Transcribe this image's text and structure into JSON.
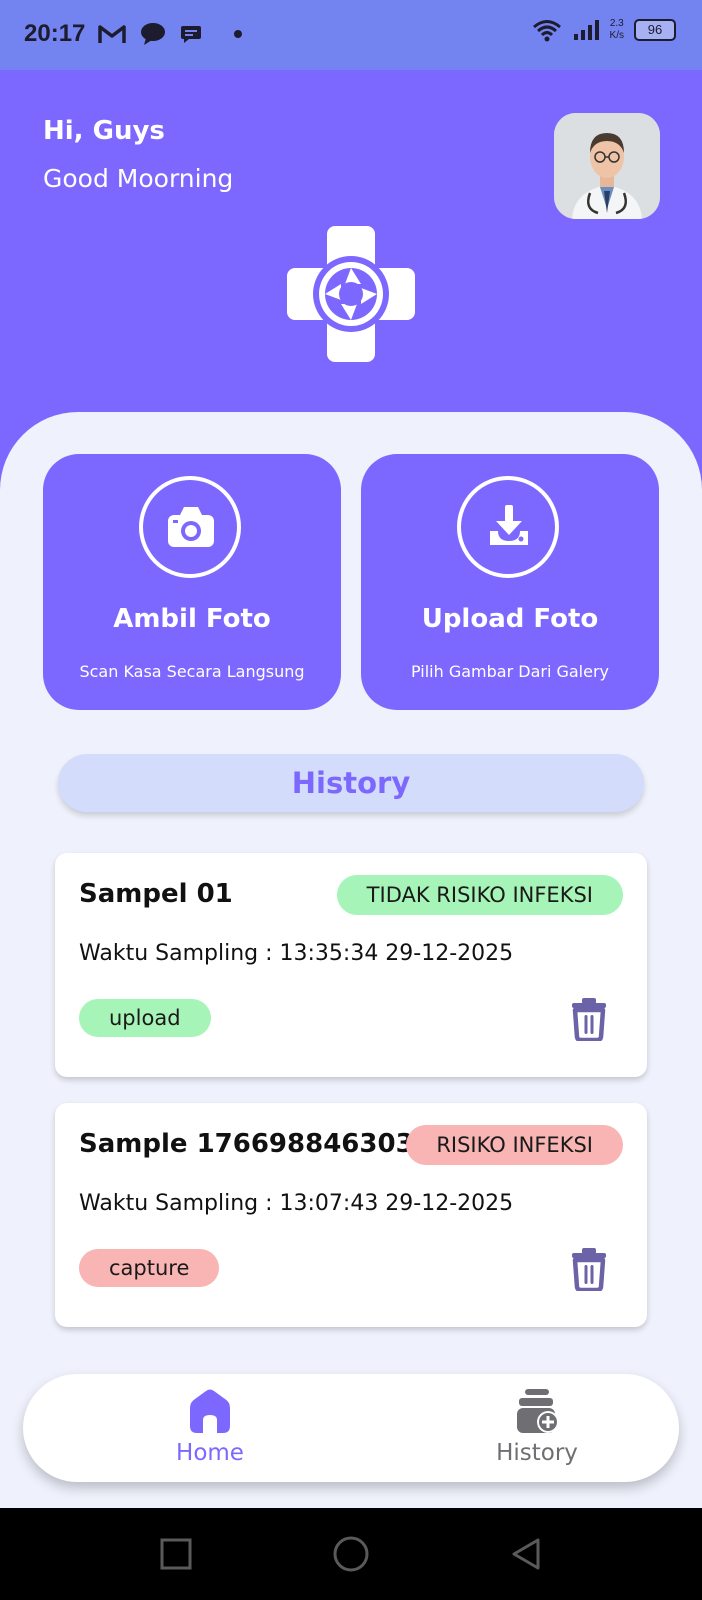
{
  "status_bar": {
    "time": "20:17",
    "speed_value": "2.3",
    "speed_unit": "K/s",
    "battery": "96",
    "left_icons": [
      "gmail-icon",
      "chat-icon",
      "message-icon",
      "dot-icon"
    ],
    "right_icons": [
      "wifi-icon",
      "signal-icon",
      "battery-icon"
    ]
  },
  "header": {
    "greeting": "Hi, Guys",
    "subgreeting": "Good Moorning",
    "avatar_icon": "doctor-avatar",
    "logo_icon": "medical-cross-camera-logo"
  },
  "actions": [
    {
      "title": "Ambil Foto",
      "subtitle": "Scan Kasa Secara Langsung",
      "icon": "camera-icon"
    },
    {
      "title": "Upload Foto",
      "subtitle": "Pilih Gambar Dari Galery",
      "icon": "download-icon"
    }
  ],
  "history_header": "History",
  "history": [
    {
      "title": "Sampel 01",
      "risk": "TIDAK RISIKO INFEKSI",
      "time": "Waktu Sampling : 13:35:34 29-12-2025",
      "source": "upload"
    },
    {
      "title": "Sample 1766988463032",
      "risk": "RISIKO INFEKSI",
      "time": "Waktu Sampling : 13:07:43 29-12-2025",
      "source": "capture"
    }
  ],
  "bottom_nav": {
    "home": "Home",
    "history": "History"
  },
  "colors": {
    "primary": "#7c68ff",
    "status_bar": "#7383ef",
    "background": "#eff1fc",
    "safe": "#a6f4b8",
    "risk": "#f9b4b4",
    "history_pill": "#d4dcfb",
    "icon_dark": "#6b62a8"
  }
}
